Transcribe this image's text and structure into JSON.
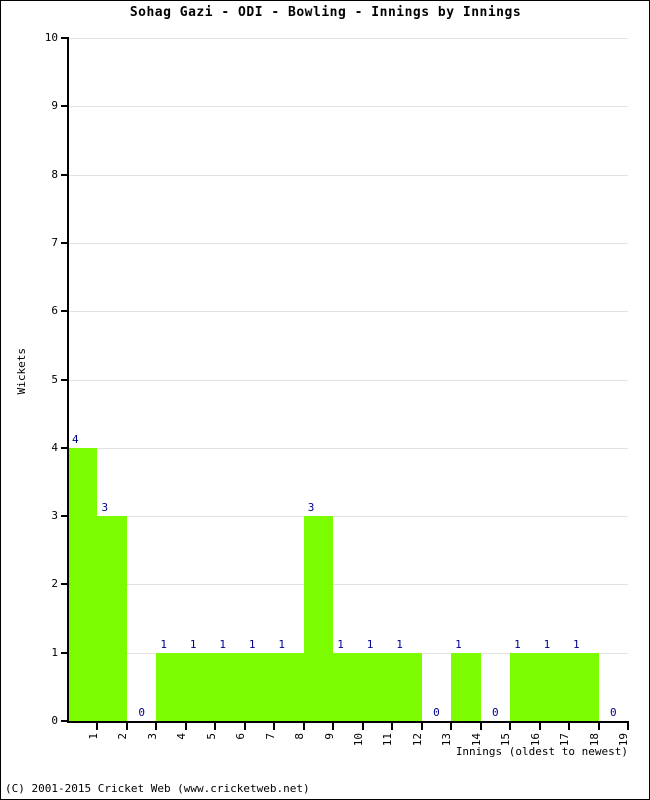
{
  "footer": {
    "text": "(C) 2001-2015 Cricket Web (www.cricketweb.net)"
  },
  "colors": {
    "bar": "#7CFC00",
    "bar_label": "#00008B",
    "gridline": "#e3e3e3",
    "axis": "#000000",
    "background": "#ffffff"
  },
  "chart_data": {
    "type": "bar",
    "title": "Sohag Gazi - ODI - Bowling - Innings by Innings",
    "xlabel": "Innings (oldest to newest)",
    "ylabel": "Wickets",
    "categories": [
      "1",
      "2",
      "3",
      "4",
      "5",
      "6",
      "7",
      "8",
      "9",
      "10",
      "11",
      "12",
      "13",
      "14",
      "15",
      "16",
      "17",
      "18",
      "19"
    ],
    "values": [
      4,
      3,
      0,
      1,
      1,
      1,
      1,
      1,
      3,
      1,
      1,
      1,
      0,
      1,
      0,
      1,
      1,
      1,
      0
    ],
    "point_labels": [
      "4",
      "3",
      "0",
      "1",
      "1",
      "1",
      "1",
      "1",
      "3",
      "1",
      "1",
      "1",
      "0",
      "1",
      "0",
      "1",
      "1",
      "1",
      "0"
    ],
    "ylim": [
      0,
      10
    ],
    "yticks": [
      0,
      1,
      2,
      3,
      4,
      5,
      6,
      7,
      8,
      9,
      10
    ],
    "ytick_labels": [
      "0",
      "1",
      "2",
      "3",
      "4",
      "5",
      "6",
      "7",
      "8",
      "9",
      "10"
    ],
    "grid": true,
    "legend": null,
    "series_name": "Wickets"
  }
}
